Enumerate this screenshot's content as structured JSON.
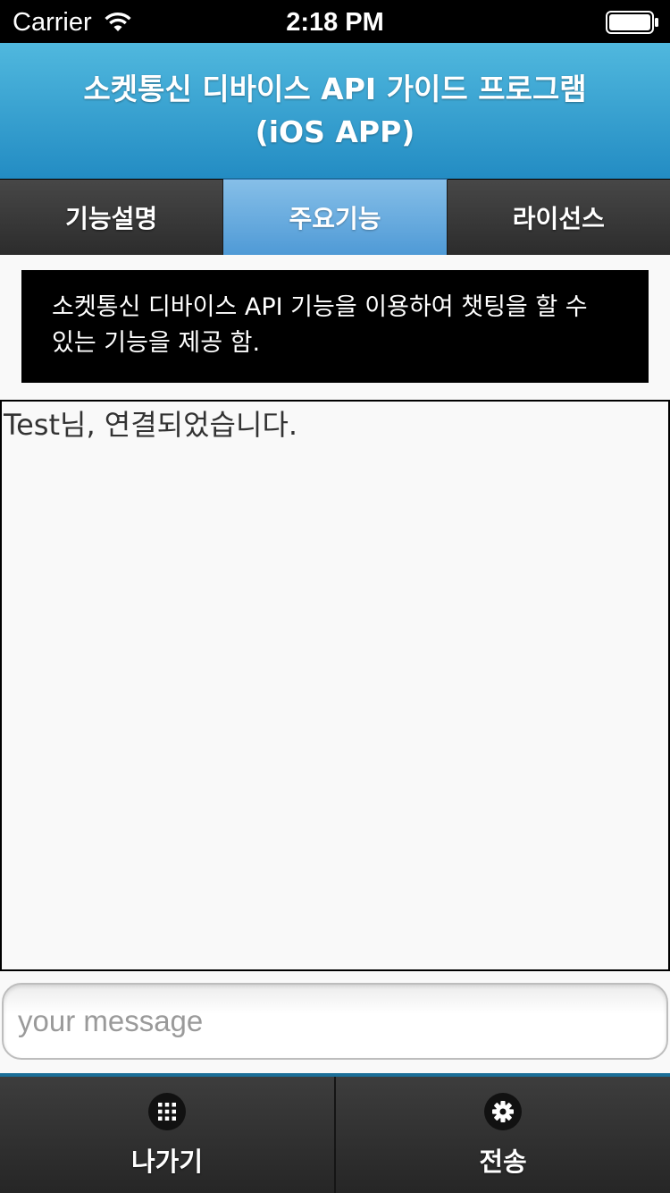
{
  "status_bar": {
    "carrier": "Carrier",
    "time": "2:18 PM"
  },
  "header": {
    "title": "소켓통신 디바이스 API 가이드 프로그램 (iOS APP)"
  },
  "tabs": [
    {
      "label": "기능설명",
      "active": false
    },
    {
      "label": "주요기능",
      "active": true
    },
    {
      "label": "라이선스",
      "active": false
    }
  ],
  "description": {
    "text": "소켓통신 디바이스 API 기능을 이용하여 챗팅을 할 수 있는 기능을 제공 함."
  },
  "chat": {
    "messages": [
      "Test님, 연결되었습니다."
    ]
  },
  "message_input": {
    "placeholder": "your message",
    "value": ""
  },
  "footer": {
    "exit_label": "나가기",
    "exit_icon": "grid-icon",
    "send_label": "전송",
    "send_icon": "gear-icon"
  },
  "colors": {
    "header_top": "#50b8de",
    "header_bottom": "#238cc3",
    "tab_active": "#5b9fd8",
    "tab_inactive": "#3a3a3a",
    "footer": "#2f2f2f"
  }
}
